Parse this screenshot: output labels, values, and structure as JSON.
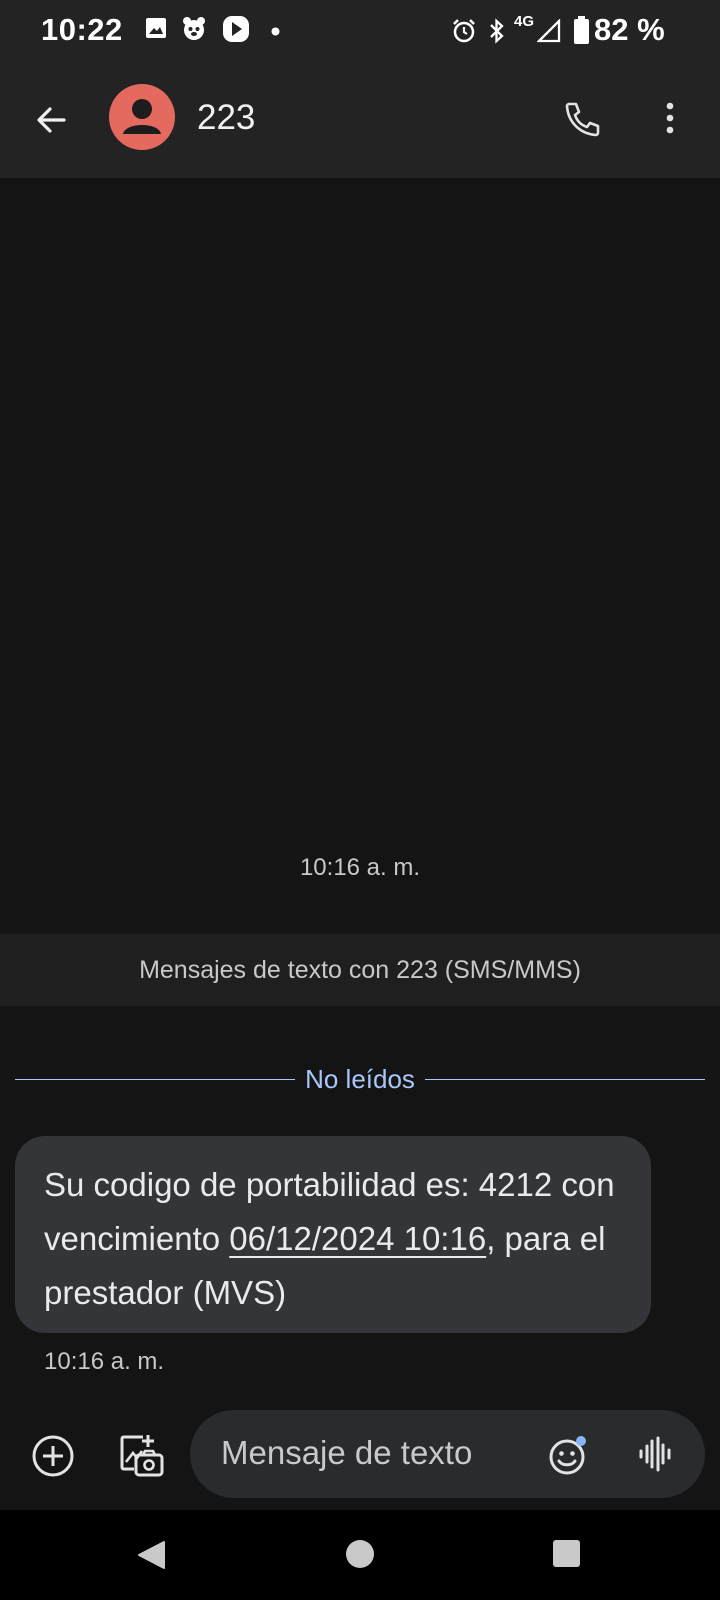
{
  "status_bar": {
    "time": "10:22",
    "network_label": "4G",
    "battery_text": "82 %",
    "icons": [
      "gallery-icon",
      "character-icon",
      "play-icon",
      "notification-dot-icon",
      "alarm-icon",
      "bluetooth-icon",
      "signal-icon",
      "battery-icon"
    ]
  },
  "app_bar": {
    "contact_name": "223",
    "avatar_color": "#e46a5f",
    "icons": [
      "back-arrow-icon",
      "person-icon",
      "phone-icon",
      "more-vert-icon"
    ]
  },
  "conversation": {
    "timestamp_top": "10:16 a. m.",
    "sms_banner": "Mensajes de texto con 223 (SMS/MMS)",
    "unread_label": "No leídos",
    "message": {
      "text_part1": "Su codigo de portabilidad es: 4212 con vencimiento ",
      "link_text": "06/12/2024 10:16",
      "text_part2": ", para el prestador (MVS)",
      "time": "10:16 a. m."
    }
  },
  "composer": {
    "placeholder": "Mensaje de texto",
    "icons": [
      "add-circle-icon",
      "gallery-camera-icon",
      "emoji-icon",
      "voice-icon"
    ]
  },
  "colors": {
    "background": "#141414",
    "app_bar": "#232323",
    "bubble": "#333538",
    "accent": "#a8c7fa"
  }
}
